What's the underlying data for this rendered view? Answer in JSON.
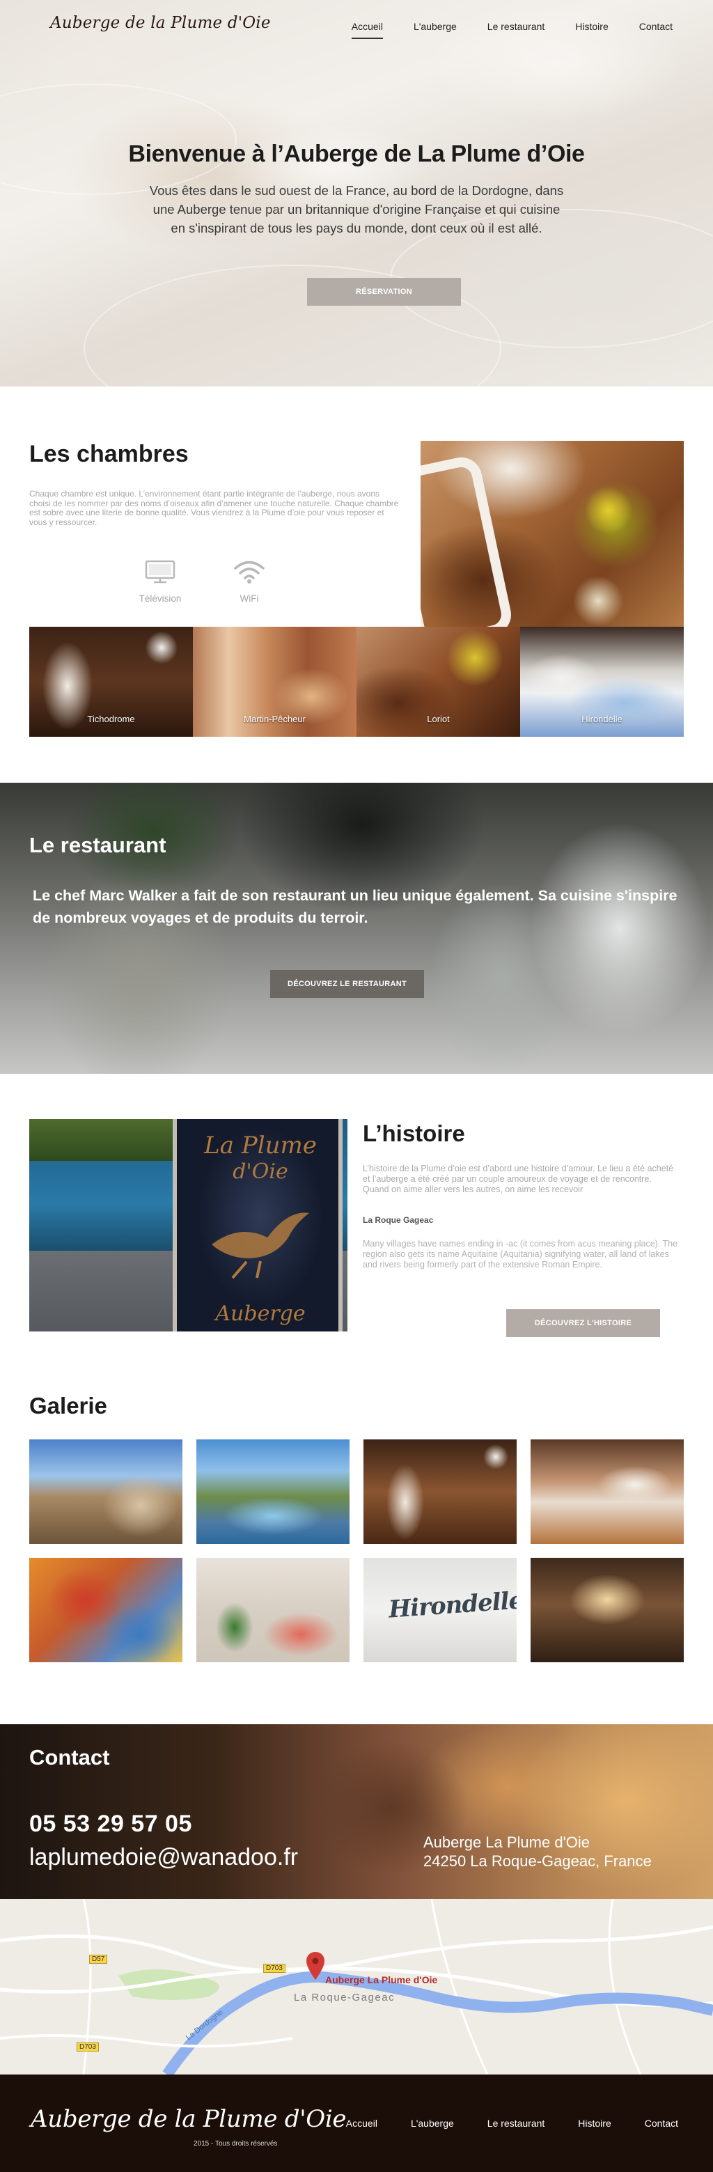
{
  "brand": "Auberge de la Plume d'Oie",
  "nav": {
    "items": [
      "Accueil",
      "L'auberge",
      "Le restaurant",
      "Histoire",
      "Contact"
    ],
    "active": "Accueil"
  },
  "hero": {
    "title": "Bienvenue à l’Auberge de La Plume d’Oie",
    "text": "Vous êtes dans le sud ouest de la France, au bord de la Dordogne, dans une Auberge tenue par un britannique d'origine Française et qui cuisine en s'inspirant de tous les pays du monde, dont ceux où il est allé.",
    "button": "RÉSERVATION"
  },
  "chambres": {
    "title": "Les chambres",
    "text": "Chaque chambre est unique.  L’environnement étant partie intégrante de l’auberge, nous avons choisi de les nommer par des noms d’oiseaux afin d’amener une touche naturelle. Chaque chambre est sobre avec une literie de bonne qualité. Vous viendrez à la Plume d’oie pour vous reposer et vous y ressourcer.",
    "amenities": [
      {
        "label": "Télévision",
        "icon": "tv-icon"
      },
      {
        "label": "WiFi",
        "icon": "wifi-icon"
      }
    ],
    "rooms": [
      "Tichodrome",
      "Martin-Pêcheur",
      "Loriot",
      "Hirondelle"
    ]
  },
  "restaurant": {
    "title": "Le restaurant",
    "text": "Le chef Marc Walker a fait de son restaurant un lieu unique également. Sa cuisine s'inspire de nombreux voyages et de produits du terroir.",
    "button": "DÉCOUVREZ LE RESTAURANT"
  },
  "histoire": {
    "title": "L’histoire",
    "text": "L’histoire de la Plume d’oie est d’abord une histoire d’amour. Le lieu a été acheté et l’auberge a été créé par un couple amoureux de voyage et de rencontre. Quand on aime aller vers les autres, on aime les recevoir",
    "subtitle": "La Roque Gageac",
    "text2": "Many villages have names ending in -ac (it comes from acus meaning place). The region also gets its name Aquitaine (Aquitania) signifying water, all land of lakes and rivers being  formerly  part of the extensive Roman Empire.",
    "button": "DÉCOUVREZ L'HISTOIRE",
    "sign_lines": [
      "La Plume",
      "d'Oie",
      "Auberge"
    ]
  },
  "galerie": {
    "title": "Galerie",
    "sign_text": "Hirondelle"
  },
  "contact": {
    "title": "Contact",
    "phone": "05 53 29 57 05",
    "email": "laplumedoie@wanadoo.fr",
    "address_line1": "Auberge La Plume d'Oie",
    "address_line2": "24250 La Roque-Gageac, France"
  },
  "map": {
    "pin_label": "Auberge La Plume d'Oie",
    "town": "La Roque-Gageac",
    "river": "La Dordogne",
    "roads": [
      "D57",
      "D703",
      "D703"
    ]
  },
  "footer": {
    "brand": "Auberge de la Plume d'Oie",
    "copyright": "2015 - Tous droits réservés",
    "items": [
      "Accueil",
      "L'auberge",
      "Le restaurant",
      "Histoire",
      "Contact"
    ]
  },
  "colors": {
    "button_grey": "#b3aca6",
    "footer_bg": "#1b0d07",
    "pin_red": "#d23b33"
  }
}
